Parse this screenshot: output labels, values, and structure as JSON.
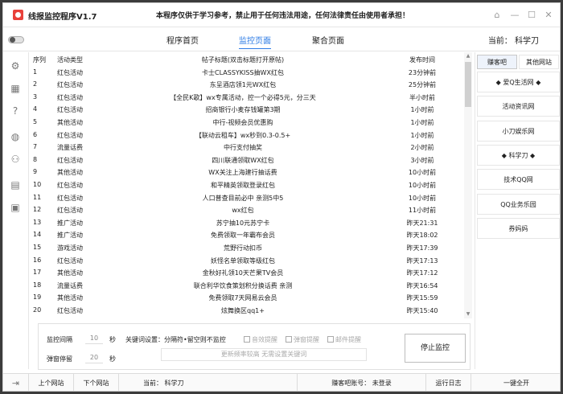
{
  "app": {
    "title": "线报监控程序V1.7",
    "notice": "本程序仅供于学习参考，禁止用于任何违法用途，任何法律责任由使用者承担！"
  },
  "window_buttons": {
    "skin": "⌂",
    "minimize": "—",
    "maximize": "☐",
    "close": "✕"
  },
  "nav": {
    "tabs": [
      {
        "label": "程序首页",
        "active": false
      },
      {
        "label": "监控页面",
        "active": true
      },
      {
        "label": "聚合页面",
        "active": false
      }
    ],
    "current_user": "当前：  科学刀"
  },
  "left_icons": [
    "gear-icon",
    "qrcode-icon",
    "help-icon",
    "globe-icon",
    "users-icon",
    "doc-icon",
    "save-icon"
  ],
  "table": {
    "headers": {
      "idx": "序列",
      "type": "活动类型",
      "title": "帖子标题(双击标题打开原帖)",
      "time": "发布时间"
    },
    "rows": [
      {
        "idx": "1",
        "type": "红包活动",
        "title": "卡士CLASSYKISS抽WX红包",
        "time": "23分钟前"
      },
      {
        "idx": "2",
        "type": "红包活动",
        "title": "东呈酒店领1元WX红包",
        "time": "25分钟前"
      },
      {
        "idx": "3",
        "type": "红包活动",
        "title": "【全民K歌】wx专属活动，控一个必得5元，分三天",
        "time": "半小时前"
      },
      {
        "idx": "4",
        "type": "红包活动",
        "title": "招商银行小麦存钱罐第3期",
        "time": "1小时前"
      },
      {
        "idx": "5",
        "type": "其他活动",
        "title": "中行-视频会员优惠购",
        "time": "1小时前"
      },
      {
        "idx": "6",
        "type": "红包活动",
        "title": "【联动云租车】wx秒到0.3-0.5+",
        "time": "1小时前"
      },
      {
        "idx": "7",
        "type": "流量话费",
        "title": "中行支付抽奖",
        "time": "2小时前"
      },
      {
        "idx": "8",
        "type": "红包活动",
        "title": "四川联通领取WX红包",
        "time": "3小时前"
      },
      {
        "idx": "9",
        "type": "其他活动",
        "title": "WX关注上海建行抽话费",
        "time": "10小时前"
      },
      {
        "idx": "10",
        "type": "红包活动",
        "title": "和平精英领取登录红包",
        "time": "10小时前"
      },
      {
        "idx": "11",
        "type": "红包活动",
        "title": "人口普查目前必中  亲测5中5",
        "time": "10小时前"
      },
      {
        "idx": "12",
        "type": "红包活动",
        "title": "wx红包",
        "time": "11小时前"
      },
      {
        "idx": "13",
        "type": "推广活动",
        "title": "苏宁抽10元苏宁卡",
        "time": "昨天21:31"
      },
      {
        "idx": "14",
        "type": "推广活动",
        "title": "免费领取一年霸布会员",
        "time": "昨天18:02"
      },
      {
        "idx": "15",
        "type": "游戏活动",
        "title": "荒野行动扣币",
        "time": "昨天17:39"
      },
      {
        "idx": "16",
        "type": "红包活动",
        "title": "妖怪名单领取等级红包",
        "time": "昨天17:13"
      },
      {
        "idx": "17",
        "type": "其他活动",
        "title": "金秋好礼领10天芒果TV会员",
        "time": "昨天17:12"
      },
      {
        "idx": "18",
        "type": "流量话费",
        "title": "联合利华饮食策划积分换话费 亲测",
        "time": "昨天16:54"
      },
      {
        "idx": "19",
        "type": "其他活动",
        "title": "免费领取7天网易云会员",
        "time": "昨天15:59"
      },
      {
        "idx": "20",
        "type": "红包活动",
        "title": "炫舞换区qq1+",
        "time": "昨天15:40"
      }
    ]
  },
  "settings": {
    "interval_label": "监控间隔",
    "interval_value": "10",
    "interval_unit": "秒",
    "popup_label": "弹窗停留",
    "popup_value": "20",
    "popup_unit": "秒",
    "keyword_label": "关键词设置：分隔符•留空则不监控",
    "checkboxes": [
      "音效提醒",
      "弹窗提醒",
      "邮件提醒"
    ],
    "keyword_placeholder": "更新频率较高  无需设置关键词",
    "stop_button": "停止监控"
  },
  "right_panel": {
    "tabs": [
      {
        "label": "赚客吧",
        "active": true
      },
      {
        "label": "其他网站",
        "active": false
      }
    ],
    "items": [
      "◆ 爱Q生活网 ◆",
      "活动资讯网",
      "小刀娱乐网",
      "◆ 科学刀 ◆",
      "技术QQ网",
      "QQ业务乐园",
      "券妈妈"
    ]
  },
  "statusbar": {
    "prev": "上个网站",
    "next": "下个网站",
    "current": "当前：  科学刀",
    "account": "赚客吧账号：  未登录",
    "log": "运行日志",
    "top": "一键全开"
  }
}
